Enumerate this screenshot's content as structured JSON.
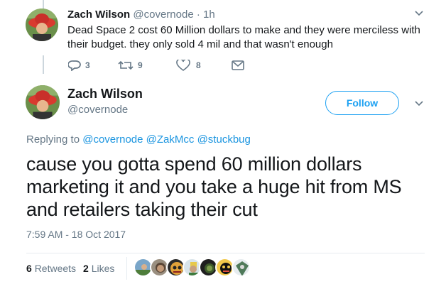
{
  "parent_tweet": {
    "author_name": "Zach Wilson",
    "author_handle": "@covernode",
    "separator": "·",
    "time": "1h",
    "text": "Dead Space 2 cost 60 Million dollars to make and they were merciless with their budget. they only sold 4 mil and that wasn't enough",
    "reply_count": "3",
    "retweet_count": "9",
    "like_count": "8"
  },
  "main_tweet": {
    "author_name": "Zach Wilson",
    "author_handle": "@covernode",
    "follow_label": "Follow",
    "replying_prefix": "Replying to",
    "replying_mentions": [
      "@covernode",
      "@ZakMcc",
      "@stuckbug"
    ],
    "text": "cause you gotta spend 60 million dollars marketing it and you take a huge hit from MS and retailers taking their cut",
    "timestamp": "7:59 AM - 18 Oct 2017",
    "retweets_count": "6",
    "retweets_label": "Retweets",
    "likes_count": "2",
    "likes_label": "Likes"
  },
  "icons": [
    "reply-icon",
    "retweet-icon",
    "like-icon",
    "message-icon",
    "chevron-down-icon"
  ],
  "colors": {
    "accent": "#1da1f2",
    "mention": "#1b95e0",
    "muted": "#657786",
    "text": "#14171a",
    "border": "#e6ecf0"
  }
}
